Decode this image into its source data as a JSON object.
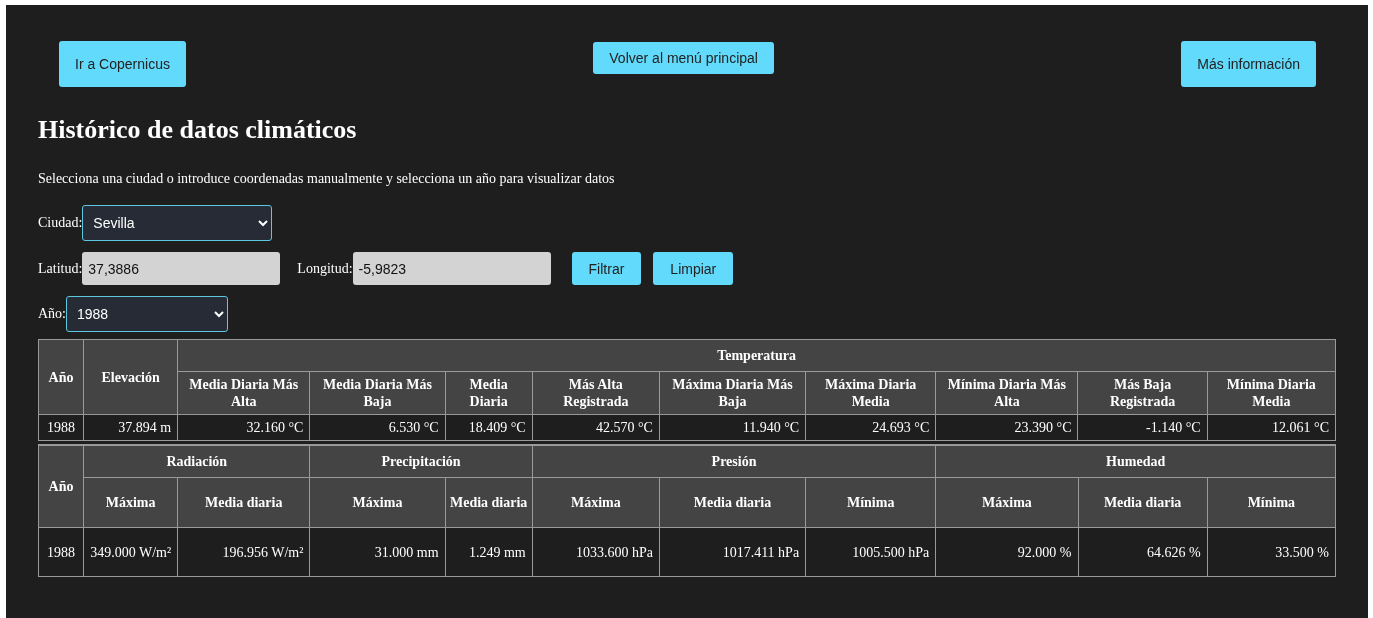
{
  "nav_buttons": [
    "Ir a Copernicus",
    "Volver al menú principal",
    "Más información"
  ],
  "title": "Histórico de datos climáticos",
  "subtitle": "Selecciona una ciudad o introduce coordenadas manualmente y selecciona un año para visualizar datos",
  "city": {
    "label": "Ciudad:",
    "value": "Sevilla"
  },
  "latitude": {
    "label": "Latitud:",
    "value": "37,3886"
  },
  "longitude": {
    "label": "Longitud:",
    "value": "-5,9823"
  },
  "filter_buttons": [
    "Filtrar",
    "Limpiar"
  ],
  "year": {
    "label": "Año:",
    "value": "1988"
  },
  "table_top": {
    "header_rows": [
      [
        {
          "text": "Año",
          "rowspan": 2
        },
        {
          "text": "Elevación",
          "rowspan": 2
        },
        {
          "text": "Temperatura",
          "colspan": 9
        }
      ],
      [
        {
          "text": "Media Diaria Más Alta"
        },
        {
          "text": "Media Diaria Más Baja"
        },
        {
          "text": "Media Diaria"
        },
        {
          "text": "Más Alta Registrada"
        },
        {
          "text": "Máxima Diaria Más Baja"
        },
        {
          "text": "Máxima Diaria Media"
        },
        {
          "text": "Mínima Diaria Más Alta"
        },
        {
          "text": "Más Baja Registrada"
        },
        {
          "text": "Mínima Diaria Media"
        }
      ]
    ],
    "rows": [
      [
        "1988",
        "37.894 m",
        "32.160 °C",
        "6.530 °C",
        "18.409 °C",
        "42.570 °C",
        "11.940 °C",
        "24.693 °C",
        "23.390 °C",
        "-1.140 °C",
        "12.061 °C"
      ]
    ]
  },
  "table_bottom": {
    "header_rows": [
      [
        {
          "text": "Año",
          "rowspan": 2
        },
        {
          "text": "Radiación",
          "colspan": 2
        },
        {
          "text": "Precipitación",
          "colspan": 2
        },
        {
          "text": "Presión",
          "colspan": 3
        },
        {
          "text": "Humedad",
          "colspan": 3
        }
      ],
      [
        {
          "text": "Máxima"
        },
        {
          "text": "Media diaria"
        },
        {
          "text": "Máxima"
        },
        {
          "text": "Media diaria"
        },
        {
          "text": "Máxima"
        },
        {
          "text": "Media diaria"
        },
        {
          "text": "Mínima"
        },
        {
          "text": "Máxima"
        },
        {
          "text": "Media diaria"
        },
        {
          "text": "Mínima"
        }
      ]
    ],
    "rows": [
      [
        "1988",
        "349.000 W/m²",
        "196.956 W/m²",
        "31.000 mm",
        "1.249 mm",
        "1033.600 hPa",
        "1017.411 hPa",
        "1005.500 hPa",
        "92.000 %",
        "64.626 %",
        "33.500 %"
      ]
    ]
  }
}
